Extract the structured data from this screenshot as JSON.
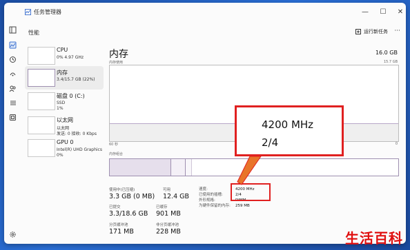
{
  "window": {
    "title": "任务管理器"
  },
  "header": {
    "heading": "性能",
    "run_new_task": "运行新任务",
    "more": "···"
  },
  "sidebar_rail": [
    "menu-icon",
    "performance-icon",
    "history-icon",
    "startup-icon",
    "users-icon",
    "details-icon",
    "services-icon",
    "settings-icon"
  ],
  "perf_list": [
    {
      "name": "CPU",
      "sub": "0% 4.97 GHz",
      "sub2": ""
    },
    {
      "name": "内存",
      "sub": "3.4/15.7 GB (22%)",
      "sub2": ""
    },
    {
      "name": "磁盘 0 (C:)",
      "sub": "SSD",
      "sub2": "1%"
    },
    {
      "name": "以太网",
      "sub": "以太网",
      "sub2": "发送: 0 接收: 0 Kbps"
    },
    {
      "name": "GPU 0",
      "sub": "Intel(R) UHD Graphics",
      "sub2": "0%"
    }
  ],
  "memory": {
    "title": "内存",
    "total": "16.0 GB",
    "usage_label": "内存使用",
    "usage_max": "15.7 GB",
    "time_left": "60 秒",
    "time_right": "0",
    "composition_label": "内存组合",
    "stats": {
      "in_use_label": "使用中(已压缩)",
      "in_use": "3.3 GB (0 MB)",
      "available_label": "可用",
      "available": "12.4 GB",
      "committed_label": "已提交",
      "committed": "3.3/18.6 GB",
      "cached_label": "已缓存",
      "cached": "901 MB",
      "paged_label": "分页缓冲池",
      "paged": "171 MB",
      "nonpaged_label": "非分页缓冲池",
      "nonpaged": "228 MB"
    },
    "details": {
      "speed_label": "速度:",
      "speed": "4200 MHz",
      "slots_label": "已使用的插槽:",
      "slots": "2/4",
      "form_label": "外形规格:",
      "form": "DIMM",
      "reserved_label": "为硬件保留的内存:",
      "reserved": "259 MB"
    }
  },
  "callout": {
    "line1": "4200 MHz",
    "line2": "2/4"
  },
  "watermark": "生活百科",
  "colors": {
    "highlight": "#e02020",
    "memory_accent": "#9e8fb0",
    "desktop": "#1f5fbd"
  }
}
